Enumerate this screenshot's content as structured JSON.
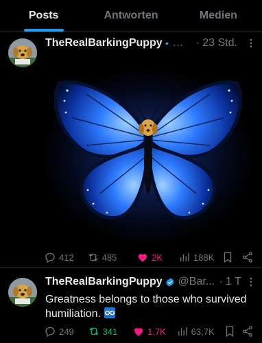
{
  "tabs": [
    {
      "label": "Posts",
      "active": true
    },
    {
      "label": "Antworten",
      "active": false
    },
    {
      "label": "Medien",
      "active": false
    }
  ],
  "posts": [
    {
      "author": "TheRealBarkingPuppy",
      "handle": "…",
      "time": "· 23 Std.",
      "image_icon": "glowing-blue-butterfly-with-dog-face",
      "stats": {
        "replies": "412",
        "reposts": "485",
        "likes": "2K",
        "views": "188K"
      }
    },
    {
      "author": "TheRealBarkingPuppy",
      "handle": "@Bar...",
      "time": "· 1 T",
      "text": "Greatness belongs to those who survived humiliation.",
      "stats": {
        "replies": "249",
        "reposts": "341",
        "likes": "1,7K",
        "views": "63,7K"
      }
    }
  ],
  "colors": {
    "accent": "#1d9bf0",
    "like": "#f91880",
    "repost": "#00ba7c",
    "muted": "#71767b"
  }
}
